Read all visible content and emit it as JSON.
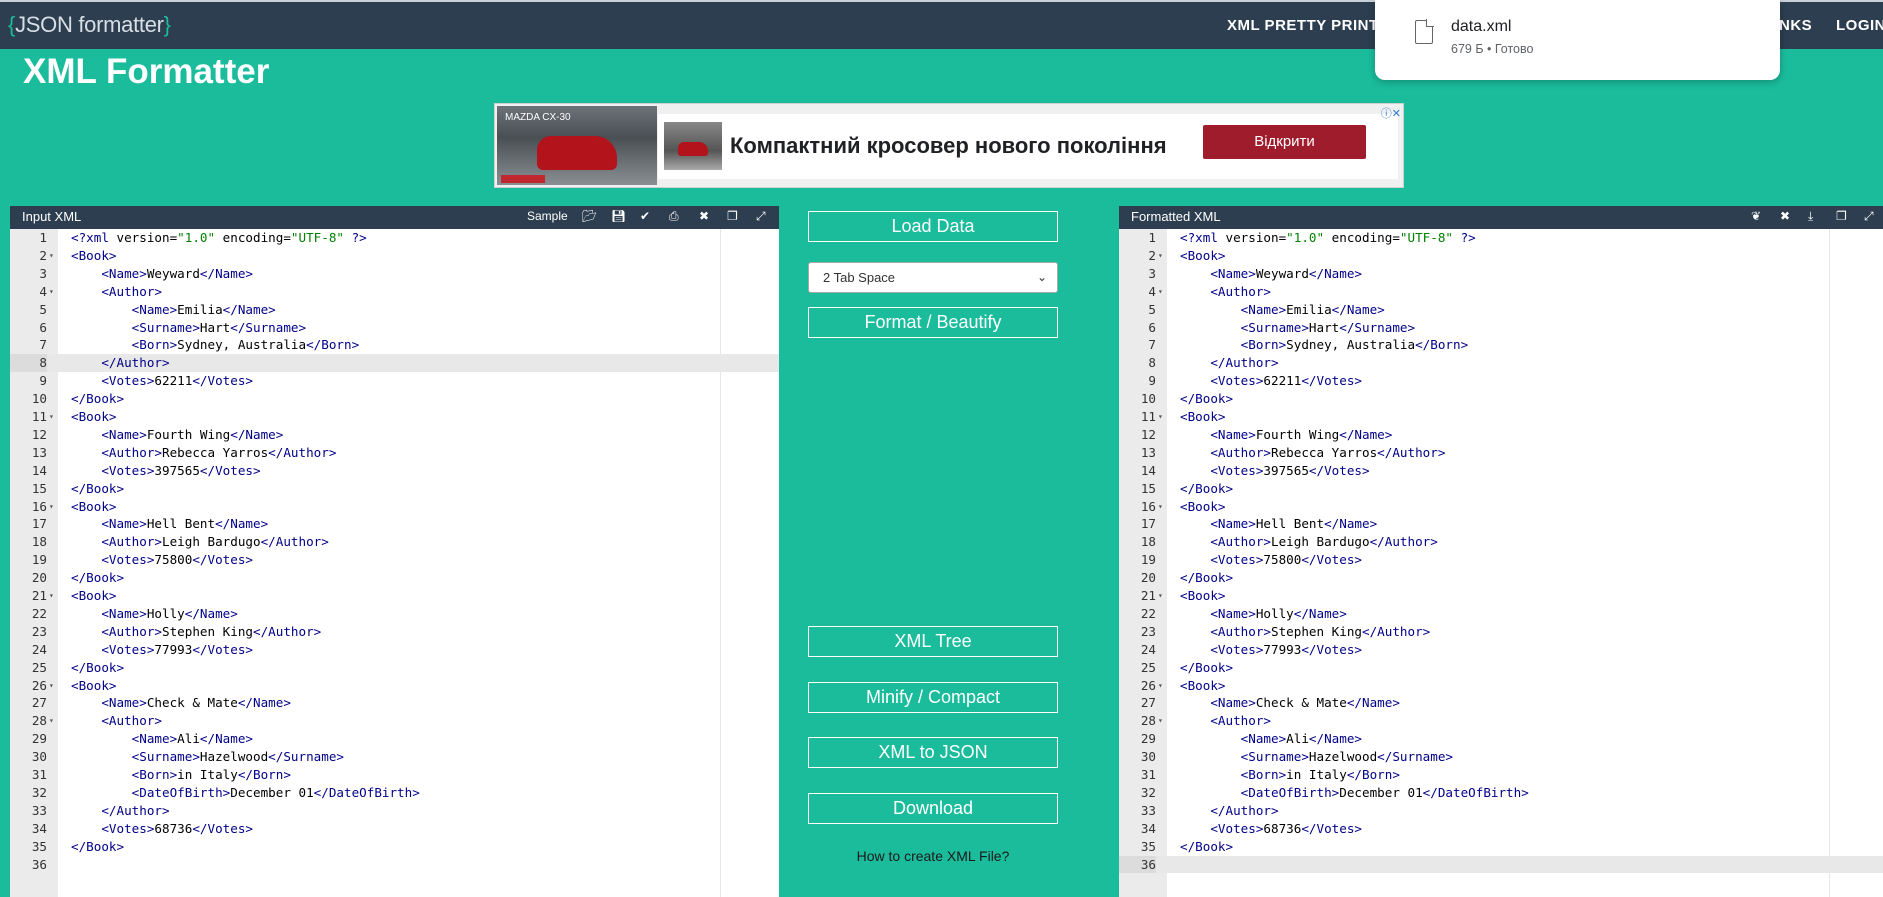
{
  "nav": {
    "logo_open": "{",
    "logo_text": "JSON formatter",
    "logo_close": "}",
    "xml_pretty_print": "XML PRETTY PRINT",
    "links": "NKS",
    "login": "LOGIN"
  },
  "download_popup": {
    "file_name": "data.xml",
    "status": "679 Б • Готово"
  },
  "page_title": "XML Formatter",
  "ad": {
    "brand": "MAZDA CX-30",
    "headline": "Компактний кросовер нового покоління",
    "button": "Відкрити",
    "icons": "ⓘ✕"
  },
  "input_panel": {
    "title": "Input XML",
    "sample": "Sample"
  },
  "output_panel": {
    "title": "Formatted XML"
  },
  "middle": {
    "load_data": "Load Data",
    "tab_space": "2 Tab Space",
    "format": "Format / Beautify",
    "xml_tree": "XML Tree",
    "minify": "Minify / Compact",
    "xml_to_json": "XML to JSON",
    "download": "Download",
    "how_to": "How to create XML File?"
  },
  "colors": {
    "teal": "#1abc9c",
    "navy": "#2c3e50",
    "tag": "#000088",
    "string": "#008000"
  },
  "code_lines": [
    "<?xml version=\"1.0\" encoding=\"UTF-8\" ?>",
    "<Book>",
    "    <Name>Weyward</Name>",
    "    <Author>",
    "        <Name>Emilia</Name>",
    "        <Surname>Hart</Surname>",
    "        <Born>Sydney, Australia</Born>",
    "    </Author>",
    "    <Votes>62211</Votes>",
    "</Book>",
    "<Book>",
    "    <Name>Fourth Wing</Name>",
    "    <Author>Rebecca Yarros</Author>",
    "    <Votes>397565</Votes>",
    "</Book>",
    "<Book>",
    "    <Name>Hell Bent</Name>",
    "    <Author>Leigh Bardugo</Author>",
    "    <Votes>75800</Votes>",
    "</Book>",
    "<Book>",
    "    <Name>Holly</Name>",
    "    <Author>Stephen King</Author>",
    "    <Votes>77993</Votes>",
    "</Book>",
    "<Book>",
    "    <Name>Check & Mate</Name>",
    "    <Author>",
    "        <Name>Ali</Name>",
    "        <Surname>Hazelwood</Surname>",
    "        <Born>in Italy</Born>",
    "        <DateOfBirth>December 01</DateOfBirth>",
    "    </Author>",
    "    <Votes>68736</Votes>",
    "</Book>",
    ""
  ],
  "line_numbers": [
    "1",
    "2",
    "3",
    "4",
    "5",
    "6",
    "7",
    "8",
    "9",
    "10",
    "11",
    "12",
    "13",
    "14",
    "15",
    "16",
    "17",
    "18",
    "19",
    "20",
    "21",
    "22",
    "23",
    "24",
    "25",
    "26",
    "27",
    "28",
    "29",
    "30",
    "31",
    "32",
    "33",
    "34",
    "35",
    "36"
  ],
  "fold_lines": [
    "2",
    "4",
    "11",
    "16",
    "21",
    "26",
    "28"
  ],
  "input_active_line": "8",
  "output_active_line": "36"
}
